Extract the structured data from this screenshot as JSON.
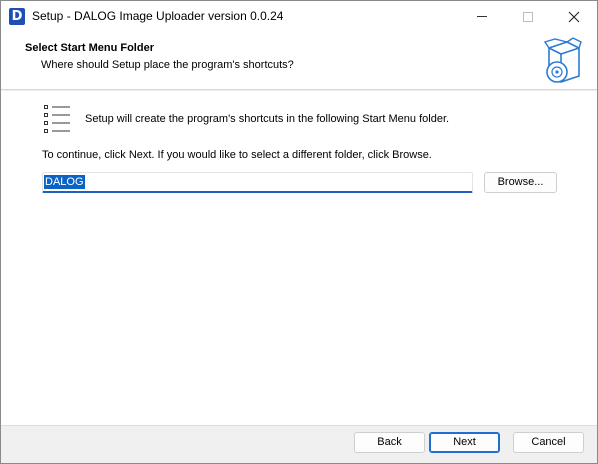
{
  "window": {
    "title": "Setup - DALOG Image Uploader version 0.0.24",
    "app_icon_letter": "D",
    "accent_color": "#1f6fd1"
  },
  "header": {
    "title": "Select Start Menu Folder",
    "subtitle": "Where should Setup place the program's shortcuts?",
    "image_icon": "software-box-disc-icon"
  },
  "content": {
    "list_icon": "list-icon",
    "info_text": "Setup will create the program's shortcuts in the following Start Menu folder.",
    "continue_text": "To continue, click Next. If you would like to select a different folder, click Browse.",
    "folder_value": "DALOG",
    "browse_label": "Browse..."
  },
  "footer": {
    "back_label": "Back",
    "next_label": "Next",
    "cancel_label": "Cancel"
  }
}
